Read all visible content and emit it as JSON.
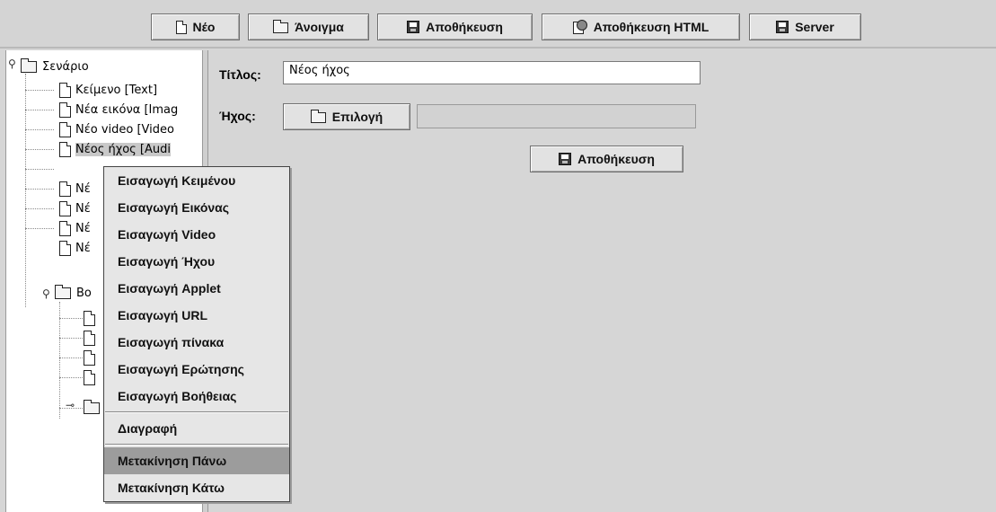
{
  "toolbar": {
    "new_label": "Νέο",
    "open_label": "Άνοιγμα",
    "save_label": "Αποθήκευση",
    "save_html_label": "Αποθήκευση HTML",
    "server_label": "Server"
  },
  "tree": {
    "root_label": "Σενάριο",
    "items": [
      "Κείμενο [Text]",
      "Νέα εικόνα [Imag",
      "Νέο video [Video",
      "Νέος ήχος [Audi",
      "Νέ",
      "Νέ",
      "Νέ",
      "Νέ"
    ],
    "subfolder_label": "Βο"
  },
  "form": {
    "title_label": "Τίτλος:",
    "title_value": "Νέος ήχος",
    "sound_label": "Ήχος:",
    "select_button": "Επιλογή",
    "sound_value": "",
    "save_button": "Αποθήκευση"
  },
  "context_menu": {
    "items": [
      "Εισαγωγή Κειμένου",
      "Εισαγωγή Εικόνας",
      "Εισαγωγή Video",
      "Εισαγωγή Ήχου",
      "Εισαγωγή Applet",
      "Εισαγωγή URL",
      "Εισαγωγή πίνακα",
      "Εισαγωγή Ερώτησης",
      "Εισαγωγή Βοήθειας"
    ],
    "delete": "Διαγραφή",
    "move_up": "Μετακίνηση Πάνω",
    "move_down": "Μετακίνηση Κάτω"
  },
  "icons": [
    "new-page-icon",
    "open-folder-icon",
    "save-disk-icon",
    "save-html-icon",
    "server-disk-icon",
    "tree-handle-icon",
    "folder-icon",
    "document-icon"
  ]
}
